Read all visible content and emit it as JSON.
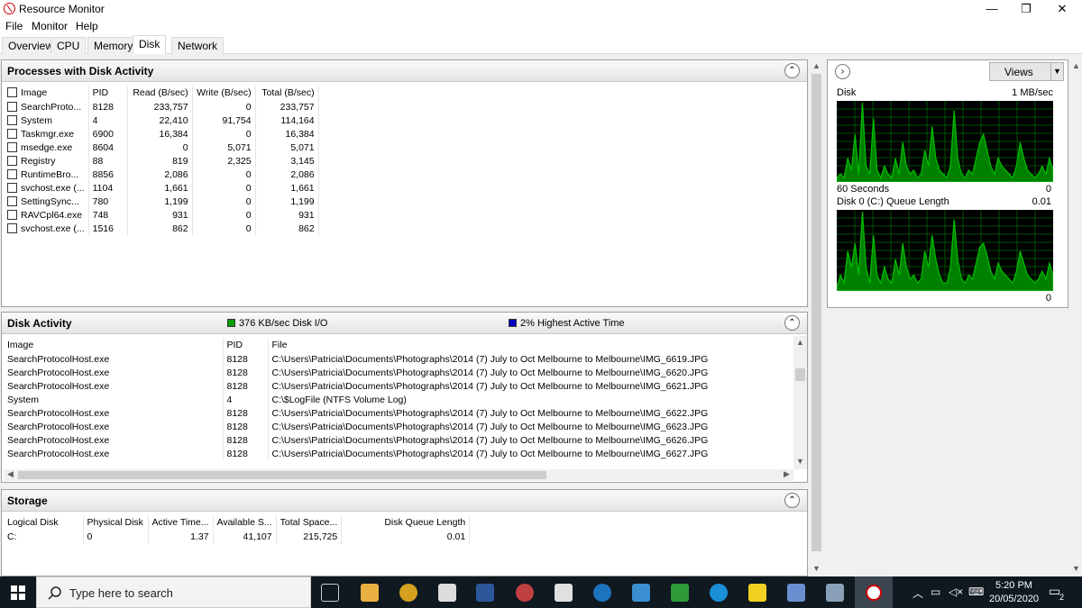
{
  "window": {
    "title": "Resource Monitor",
    "min": "—",
    "max": "❐",
    "close": "✕"
  },
  "menu": [
    "File",
    "Monitor",
    "Help"
  ],
  "tabs": [
    "Overview",
    "CPU",
    "Memory",
    "Disk",
    "Network"
  ],
  "processes": {
    "title": "Processes with Disk Activity",
    "columns": [
      "Image",
      "PID",
      "Read (B/sec)",
      "Write (B/sec)",
      "Total (B/sec)"
    ],
    "rows": [
      [
        "SearchProto...",
        "8128",
        "233,757",
        "0",
        "233,757"
      ],
      [
        "System",
        "4",
        "22,410",
        "91,754",
        "114,164"
      ],
      [
        "Taskmgr.exe",
        "6900",
        "16,384",
        "0",
        "16,384"
      ],
      [
        "msedge.exe",
        "8604",
        "0",
        "5,071",
        "5,071"
      ],
      [
        "Registry",
        "88",
        "819",
        "2,325",
        "3,145"
      ],
      [
        "RuntimeBro...",
        "8856",
        "2,086",
        "0",
        "2,086"
      ],
      [
        "svchost.exe (...",
        "1104",
        "1,661",
        "0",
        "1,661"
      ],
      [
        "SettingSync...",
        "780",
        "1,199",
        "0",
        "1,199"
      ],
      [
        "RAVCpl64.exe",
        "748",
        "931",
        "0",
        "931"
      ],
      [
        "svchost.exe (...",
        "1516",
        "862",
        "0",
        "862"
      ]
    ]
  },
  "disk_activity": {
    "title": "Disk Activity",
    "io_label": "376 KB/sec Disk I/O",
    "active_label": "2% Highest Active Time",
    "io_color": "#00a000",
    "active_color": "#0000c0",
    "columns": [
      "Image",
      "PID",
      "File"
    ],
    "rows": [
      [
        "SearchProtocolHost.exe",
        "8128",
        "C:\\Users\\Patricia\\Documents\\Photographs\\2014 (7) July to Oct Melbourne to Melbourne\\IMG_6619.JPG"
      ],
      [
        "SearchProtocolHost.exe",
        "8128",
        "C:\\Users\\Patricia\\Documents\\Photographs\\2014 (7) July to Oct Melbourne to Melbourne\\IMG_6620.JPG"
      ],
      [
        "SearchProtocolHost.exe",
        "8128",
        "C:\\Users\\Patricia\\Documents\\Photographs\\2014 (7) July to Oct Melbourne to Melbourne\\IMG_6621.JPG"
      ],
      [
        "System",
        "4",
        "C:\\$LogFile (NTFS Volume Log)"
      ],
      [
        "SearchProtocolHost.exe",
        "8128",
        "C:\\Users\\Patricia\\Documents\\Photographs\\2014 (7) July to Oct Melbourne to Melbourne\\IMG_6622.JPG"
      ],
      [
        "SearchProtocolHost.exe",
        "8128",
        "C:\\Users\\Patricia\\Documents\\Photographs\\2014 (7) July to Oct Melbourne to Melbourne\\IMG_6623.JPG"
      ],
      [
        "SearchProtocolHost.exe",
        "8128",
        "C:\\Users\\Patricia\\Documents\\Photographs\\2014 (7) July to Oct Melbourne to Melbourne\\IMG_6626.JPG"
      ],
      [
        "SearchProtocolHost.exe",
        "8128",
        "C:\\Users\\Patricia\\Documents\\Photographs\\2014 (7) July to Oct Melbourne to Melbourne\\IMG_6627.JPG"
      ]
    ]
  },
  "storage": {
    "title": "Storage",
    "columns": [
      "Logical Disk",
      "Physical Disk",
      "Active Time...",
      "Available S...",
      "Total Space...",
      "Disk Queue Length"
    ],
    "rows": [
      [
        "C:",
        "0",
        "1.37",
        "41,107",
        "215,725",
        "0.01"
      ]
    ]
  },
  "graphs": {
    "views_label": "Views",
    "disk_label": "Disk",
    "disk_max": "1 MB/sec",
    "time_label": "60 Seconds",
    "disk_min": "0",
    "queue_label": "Disk 0 (C:) Queue Length",
    "queue_max": "0.01",
    "queue_min": "0",
    "line_color": "#00c000",
    "fill_color": "#008000",
    "disk_series": [
      0.05,
      0.1,
      0.05,
      0.3,
      0.15,
      0.6,
      0.1,
      1.0,
      0.2,
      0.1,
      0.8,
      0.15,
      0.05,
      0.2,
      0.1,
      0.05,
      0.3,
      0.1,
      0.5,
      0.2,
      0.1,
      0.15,
      0.05,
      0.1,
      0.4,
      0.2,
      0.7,
      0.3,
      0.15,
      0.1,
      0.05,
      0.2,
      0.9,
      0.3,
      0.1,
      0.05,
      0.15,
      0.1,
      0.3,
      0.5,
      0.6,
      0.4,
      0.2,
      0.1,
      0.3,
      0.2,
      0.15,
      0.1,
      0.05,
      0.2,
      0.5,
      0.3,
      0.15,
      0.1,
      0.05,
      0.1,
      0.2,
      0.1,
      0.3,
      0.15
    ],
    "queue_series": [
      0.05,
      0.2,
      0.1,
      0.5,
      0.3,
      0.6,
      0.2,
      1.0,
      0.3,
      0.1,
      0.7,
      0.2,
      0.1,
      0.3,
      0.15,
      0.1,
      0.4,
      0.2,
      0.6,
      0.3,
      0.15,
      0.2,
      0.1,
      0.15,
      0.5,
      0.3,
      0.7,
      0.4,
      0.2,
      0.1,
      0.1,
      0.3,
      0.9,
      0.4,
      0.15,
      0.1,
      0.2,
      0.15,
      0.35,
      0.55,
      0.6,
      0.45,
      0.25,
      0.15,
      0.35,
      0.25,
      0.2,
      0.15,
      0.1,
      0.25,
      0.5,
      0.35,
      0.2,
      0.15,
      0.1,
      0.15,
      0.25,
      0.15,
      0.35,
      0.2
    ]
  },
  "taskbar": {
    "search_placeholder": "Type here to search",
    "time": "5:20 PM",
    "date": "20/05/2020",
    "notifications": "2"
  }
}
